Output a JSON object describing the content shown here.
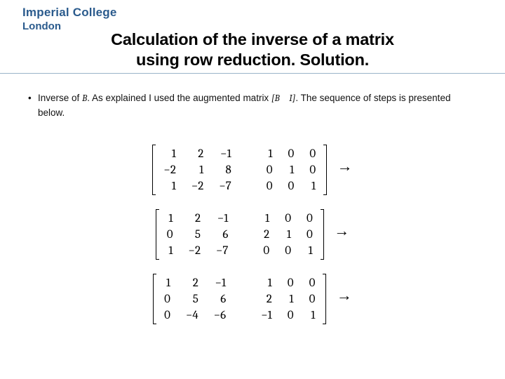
{
  "branding": {
    "line1": "Imperial College",
    "line2": "London",
    "color": "#2b5b8d"
  },
  "title": {
    "line1": "Calculation of the inverse of a matrix",
    "line2": "using row reduction. Solution."
  },
  "bullet": {
    "text_before": "Inverse of ",
    "matrix_var": "B",
    "text_mid": ". As explained I used the augmented matrix ",
    "aug_expr": "[B I]",
    "text_after": ". The sequence of steps is presented below."
  },
  "matrices": [
    {
      "left": [
        [
          "1",
          "2",
          "−1"
        ],
        [
          "−2",
          "1",
          "8"
        ],
        [
          "1",
          "−2",
          "−7"
        ]
      ],
      "right": [
        [
          "1",
          "0",
          "0"
        ],
        [
          "0",
          "1",
          "0"
        ],
        [
          "0",
          "0",
          "1"
        ]
      ]
    },
    {
      "left": [
        [
          "1",
          "2",
          "−1"
        ],
        [
          "0",
          "5",
          "6"
        ],
        [
          "1",
          "−2",
          "−7"
        ]
      ],
      "right": [
        [
          "1",
          "0",
          "0"
        ],
        [
          "2",
          "1",
          "0"
        ],
        [
          "0",
          "0",
          "1"
        ]
      ]
    },
    {
      "left": [
        [
          "1",
          "2",
          "−1"
        ],
        [
          "0",
          "5",
          "6"
        ],
        [
          "0",
          "−4",
          "−6"
        ]
      ],
      "right": [
        [
          "1",
          "0",
          "0"
        ],
        [
          "2",
          "1",
          "0"
        ],
        [
          "−1",
          "0",
          "1"
        ]
      ]
    }
  ],
  "arrow_glyph": "→"
}
